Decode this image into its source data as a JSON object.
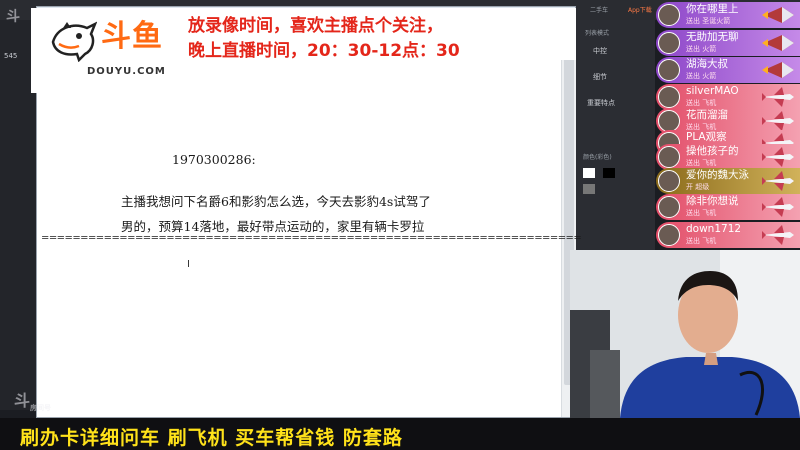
{
  "logo": {
    "cn": "斗鱼",
    "en": "DOUYU.COM"
  },
  "notice": {
    "line1": "放录像时间，喜欢主播点个关注，",
    "line2": "晚上直播时间，20：30-12点：30"
  },
  "document": {
    "user_id": "1970300286:",
    "question_line1": "主播我想问下名爵6和影豹怎么选，今天去影豹4s试驾了",
    "question_line2": "男的，预算14落地，最好带点运动的，家里有辆卡罗拉",
    "separator": "====================================================================="
  },
  "bottom_banner": "刷办卡详细问车  刷飞机  买车帮省钱  防套路",
  "watermark": {
    "top": "斗",
    "bottom": "斗",
    "sub": "房间号"
  },
  "left_panel": {
    "number": "545"
  },
  "right_panel": {
    "title": "列表模式",
    "items": [
      "中控",
      "细节",
      "重要特点"
    ],
    "color_label": "颜色(彩色)"
  },
  "taskbar_right": {
    "a": "二手车",
    "b": "App下载"
  },
  "gifts": [
    {
      "name": "你在哪里上",
      "sub": "送出 圣诞火箭",
      "style": "purple"
    },
    {
      "name": "无助加无聊",
      "sub": "送出 火箭",
      "style": "purple"
    },
    {
      "name": "湖海大叔",
      "sub": "送出 火箭",
      "style": "purple"
    },
    {
      "name": "silverMAO",
      "sub": "送出 飞机",
      "style": "red"
    },
    {
      "name": "花而溜溜",
      "sub": "送出 飞机",
      "style": "red"
    },
    {
      "name": "PLA观察",
      "sub": "送出 飞机",
      "style": "red"
    },
    {
      "name": "操他孩子的",
      "sub": "送出 飞机",
      "style": "red"
    },
    {
      "name": "爱你的魏大泳",
      "sub": "开 超级",
      "style": "gold"
    },
    {
      "name": "除非你想说",
      "sub": "送出 飞机",
      "style": "red"
    },
    {
      "name": "down1712",
      "sub": "送出 飞机",
      "style": "red"
    }
  ],
  "colors": {
    "notice_red": "#e4261a",
    "banner_yellow": "#ffe21a",
    "douyu_orange": "#ff6a13"
  }
}
